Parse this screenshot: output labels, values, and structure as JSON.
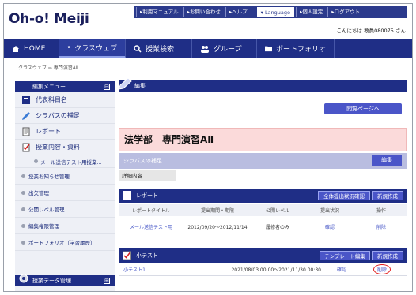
{
  "header": {
    "logo": "Oh-o! Meiji",
    "links": [
      "利用マニュアル",
      "お問い合わせ",
      "ヘルプ"
    ],
    "language": "Language",
    "settings": "個人設定",
    "logout": "ログアウト",
    "greeting": "こんにちは 教員080075 さん"
  },
  "nav": {
    "items": [
      {
        "label": "HOME",
        "icon": "home-icon"
      },
      {
        "label": "クラスウェブ",
        "icon": "graduation-cap-icon"
      },
      {
        "label": "授業検索",
        "icon": "magnifier-icon"
      },
      {
        "label": "グループ",
        "icon": "people-icon"
      },
      {
        "label": "ポートフォリオ",
        "icon": "folder-icon"
      }
    ]
  },
  "breadcrumb": "クラスウェブ ⇒ 専門演習AⅡ",
  "sidebar": {
    "header": "編集メニュー",
    "toggle": "⊟",
    "items": [
      {
        "label": "代表科目名"
      },
      {
        "label": "シラバスの補足"
      },
      {
        "label": "レポート"
      },
      {
        "label": "授業内容・資料"
      }
    ],
    "sub_item": "メール送信テスト用授業...",
    "plain_items": [
      "授業お知らせ管理",
      "出欠管理",
      "公開レベル管理",
      "編集権限管理",
      "ポートフォリオ（学習履歴）"
    ],
    "footer": "授業データ管理",
    "footer_toggle": "⊞"
  },
  "main": {
    "edit_label": "編集",
    "view_button": "閲覧ページへ",
    "course_title": "法学部　専門演習AⅡ",
    "syllabus_label": "シラバスの補足",
    "edit_button": "編集",
    "detail_label": "詳細内容",
    "report": {
      "label": "レポート",
      "status_button": "全体提出状況確認",
      "new_button": "新規作成",
      "columns": [
        "レポートタイトル",
        "提出期間・期限",
        "公開レベル",
        "提出状況",
        "操作"
      ],
      "rows": [
        {
          "title": "メール送信テスト用",
          "period": "2012/09/20～2012/11/14",
          "level": "履修者のみ",
          "status": "確認",
          "action": "削除"
        }
      ]
    },
    "quiz": {
      "label": "小テスト",
      "template_button": "テンプレート編集",
      "new_button": "新規作成",
      "rows": [
        {
          "title": "小テスト1",
          "period": "2021/08/03 00:00～2021/11/30 00:30",
          "status": "確認",
          "action": "削除"
        }
      ]
    }
  },
  "colors": {
    "navy": "#1f2e86",
    "button": "#4a55c8",
    "title_bg": "#fbdada",
    "highlight": "#e21b1b"
  }
}
